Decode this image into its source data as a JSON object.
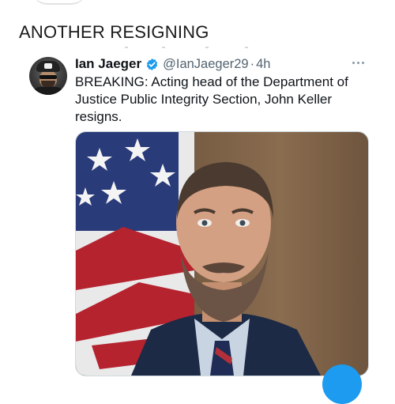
{
  "post": {
    "caption": "ANOTHER RESIGNING"
  },
  "tweet": {
    "author_name": "Ian Jaeger",
    "handle": "@IanJaeger29",
    "separator": "·",
    "time": "4h",
    "text": "BREAKING: Acting head of the Department of Justice Public Integrity Section, John Keller resigns.",
    "verified": true,
    "media": {
      "kind": "portrait photo",
      "subject": "bearded man in suit in front of US flag"
    }
  },
  "colors": {
    "accent": "#1d9bf0",
    "text_primary": "#0f1419",
    "text_secondary": "#536471"
  },
  "icons": {
    "verified": "verified-check-icon",
    "more": "more-horizontal-icon",
    "compose": "compose-fab"
  }
}
